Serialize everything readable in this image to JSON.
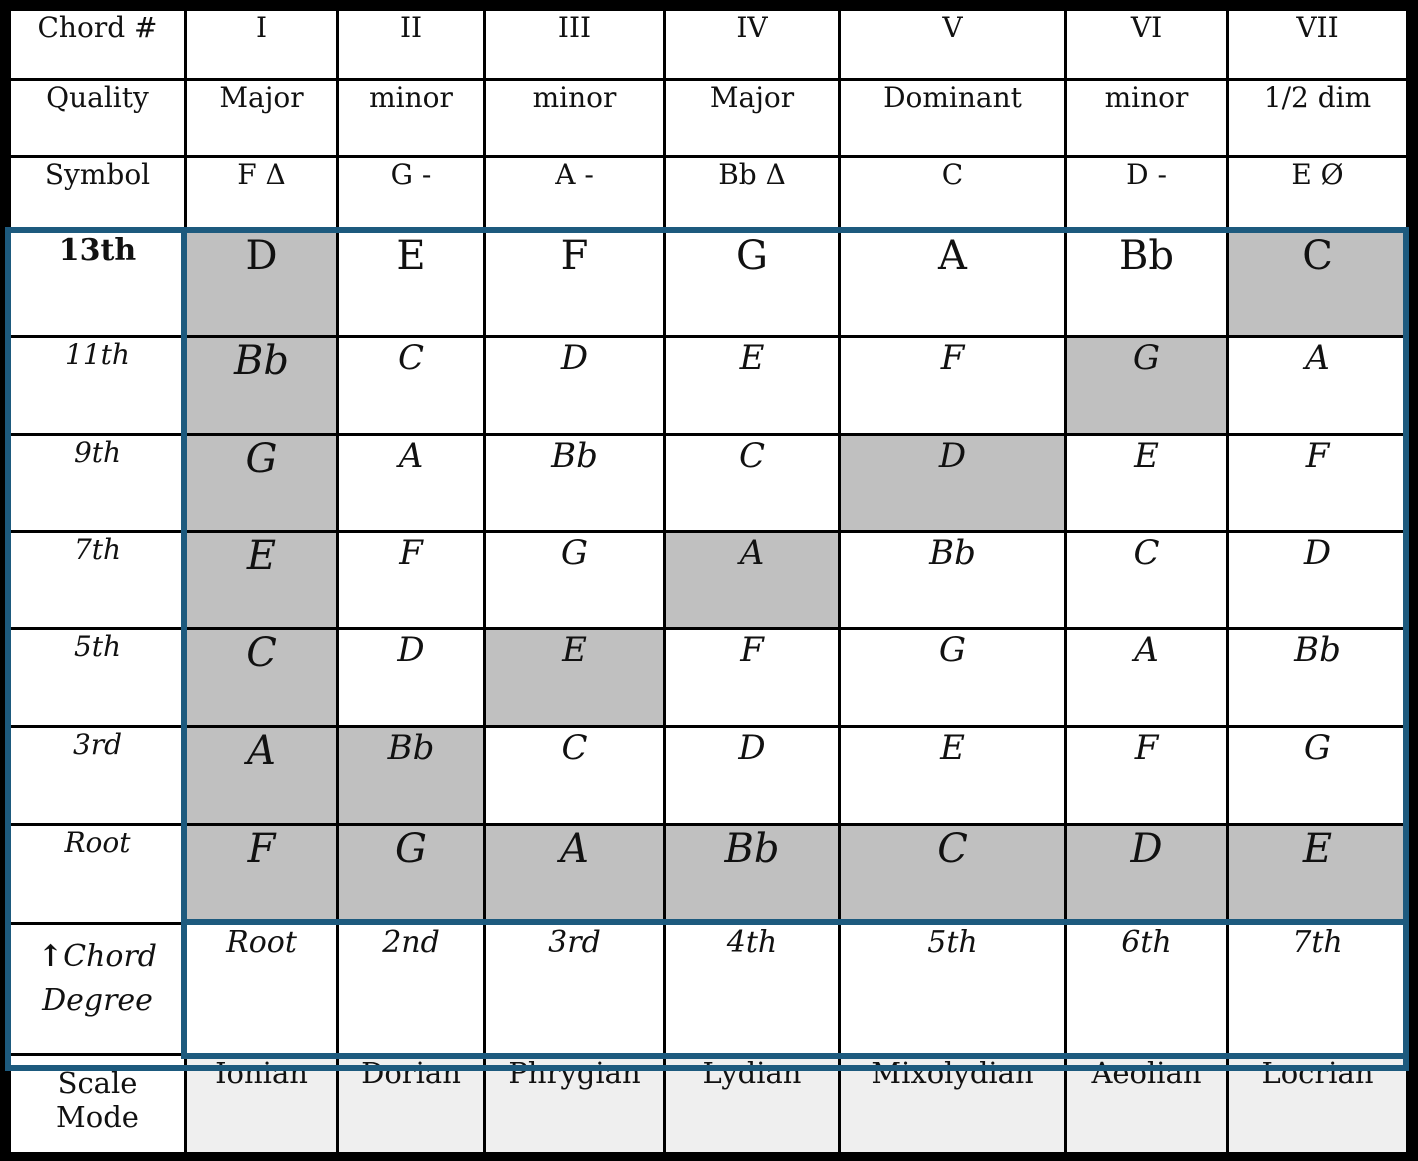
{
  "columns_header": {
    "label": "Chord #",
    "values": [
      "I",
      "II",
      "III",
      "IV",
      "V",
      "VI",
      "VII"
    ]
  },
  "quality": {
    "label": "Quality",
    "values": [
      "Major",
      "minor",
      "minor",
      "Major",
      "Dominant",
      "minor",
      "1/2 dim"
    ]
  },
  "symbol": {
    "label": "Symbol",
    "values": [
      "F Δ",
      "G -",
      "A -",
      "Bb Δ",
      "C",
      "D -",
      "E Ø"
    ]
  },
  "extension_rows": [
    {
      "label": "13th",
      "notes": [
        "D",
        "E",
        "F",
        "G",
        "A",
        "Bb",
        "C"
      ],
      "highlighted": [
        true,
        false,
        false,
        false,
        false,
        false,
        true
      ]
    },
    {
      "label": "11th",
      "notes": [
        "Bb",
        "C",
        "D",
        "E",
        "F",
        "G",
        "A"
      ],
      "highlighted": [
        true,
        false,
        false,
        false,
        false,
        true,
        false
      ]
    },
    {
      "label": "9th",
      "notes": [
        "G",
        "A",
        "Bb",
        "C",
        "D",
        "E",
        "F"
      ],
      "highlighted": [
        true,
        false,
        false,
        false,
        true,
        false,
        false
      ]
    },
    {
      "label": "7th",
      "notes": [
        "E",
        "F",
        "G",
        "A",
        "Bb",
        "C",
        "D"
      ],
      "highlighted": [
        true,
        false,
        false,
        true,
        false,
        false,
        false
      ]
    },
    {
      "label": "5th",
      "notes": [
        "C",
        "D",
        "E",
        "F",
        "G",
        "A",
        "Bb"
      ],
      "highlighted": [
        true,
        false,
        true,
        false,
        false,
        false,
        false
      ]
    },
    {
      "label": "3rd",
      "notes": [
        "A",
        "Bb",
        "C",
        "D",
        "E",
        "F",
        "G"
      ],
      "highlighted": [
        true,
        true,
        false,
        false,
        false,
        false,
        false
      ]
    },
    {
      "label": "Root",
      "notes": [
        "F",
        "G",
        "A",
        "Bb",
        "C",
        "D",
        "E"
      ],
      "highlighted": [
        true,
        true,
        true,
        true,
        true,
        true,
        true
      ]
    }
  ],
  "chord_degree": {
    "arrow_icon": "↑",
    "label_line1": "Chord",
    "label_line2": "Degree",
    "values": [
      "Root",
      "2nd",
      "3rd",
      "4th",
      "5th",
      "6th",
      "7th"
    ]
  },
  "scale_mode": {
    "label_line1": "Scale",
    "label_line2": "Mode",
    "values": [
      "Ionian",
      "Dorian",
      "Phrygian",
      "Lydian",
      "Mixolydian",
      "Aeolian",
      "Locrian"
    ]
  },
  "colors": {
    "highlight": "#c0c0c0",
    "outline": "#1d5a7e",
    "light_row": "#efefef"
  }
}
